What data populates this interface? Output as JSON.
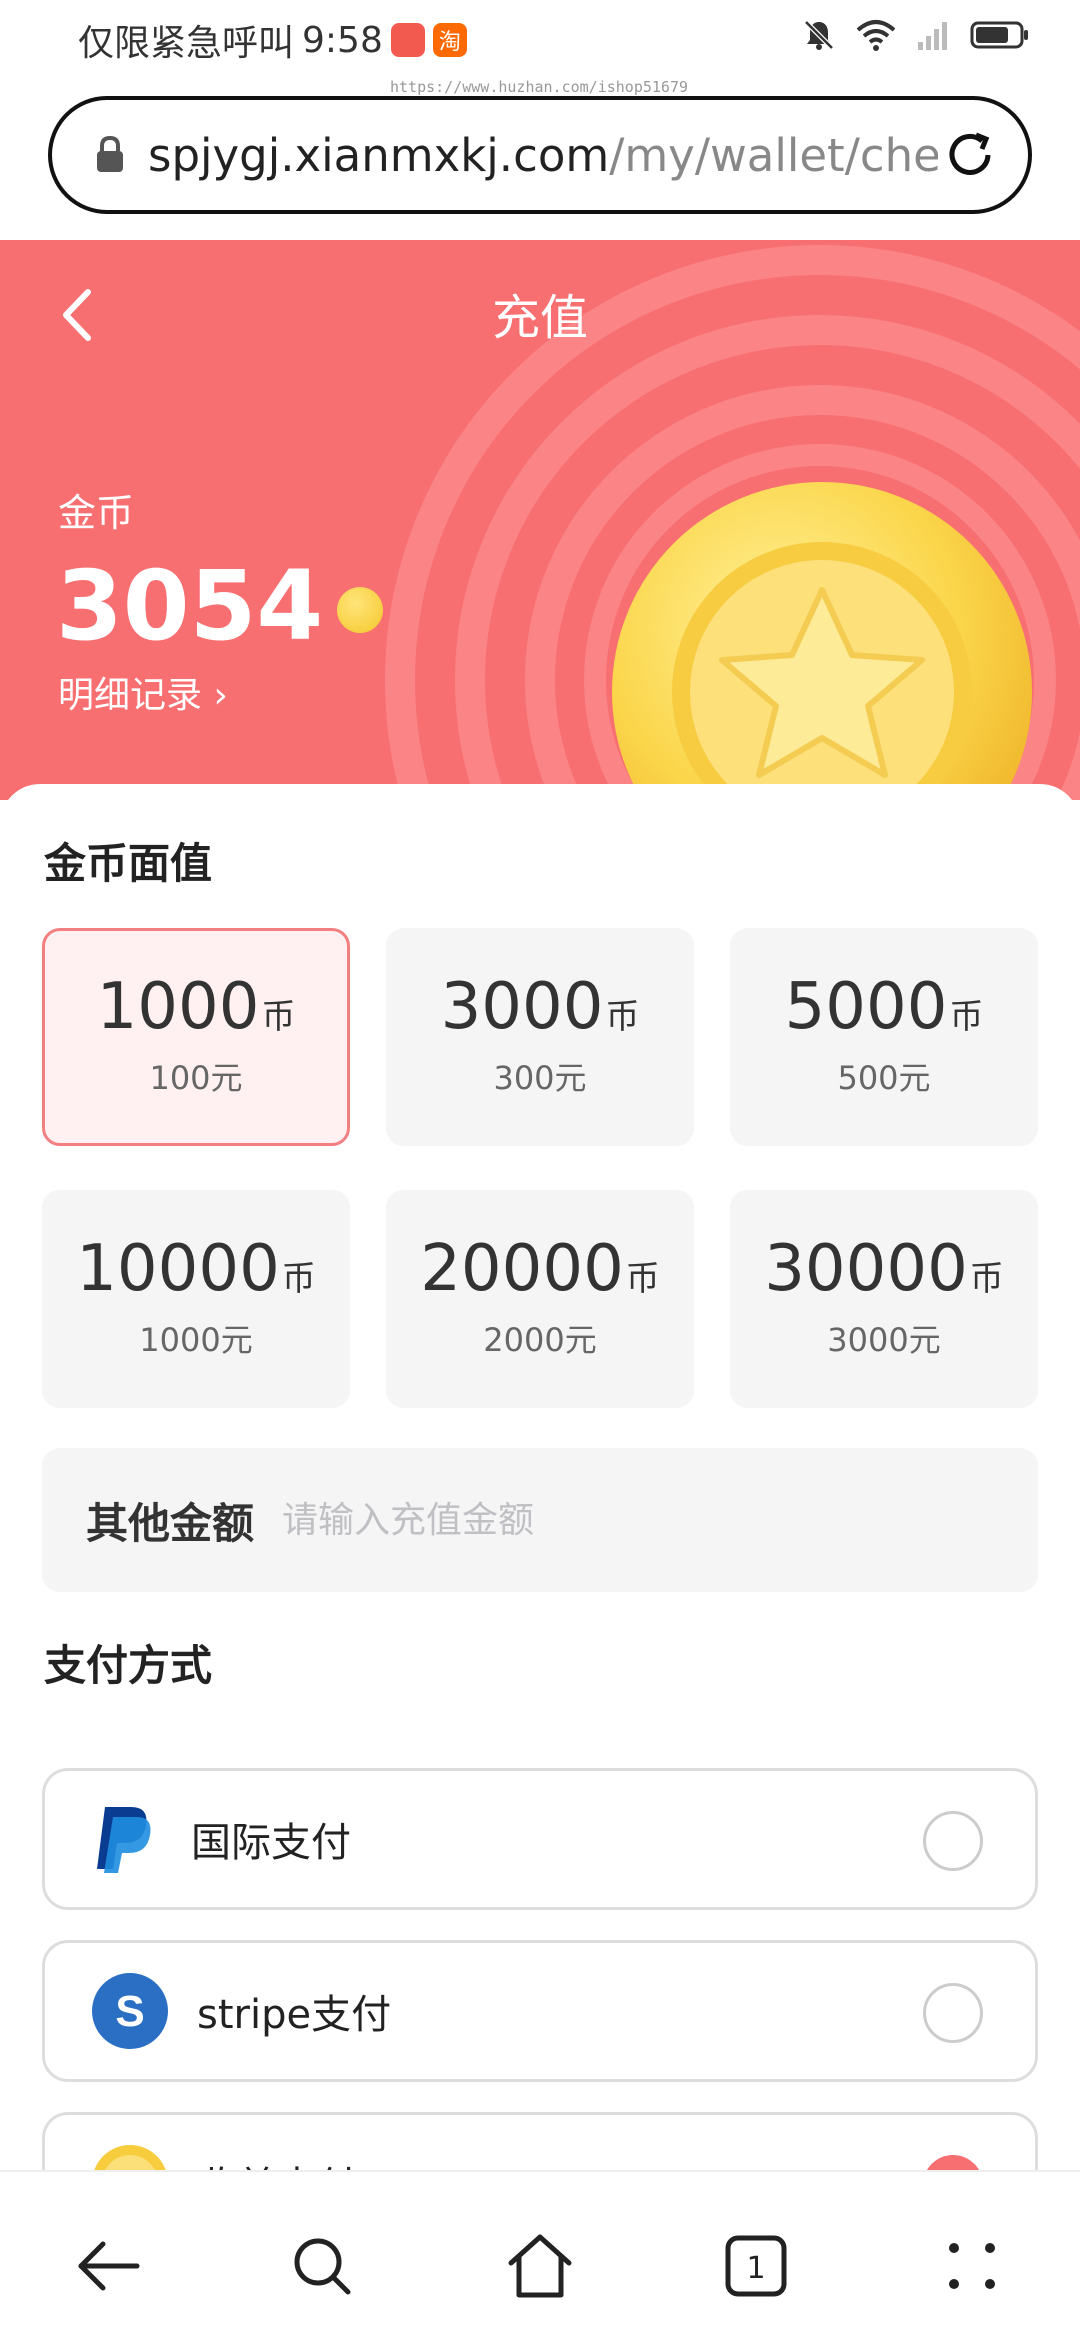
{
  "status_bar": {
    "carrier_text": "仅限紧急呼叫",
    "time": "9:58",
    "app_badge": "淘"
  },
  "browser": {
    "url_host": "spjygj.xianmxkj.com",
    "url_path": "/my/wallet/che",
    "watermark": "https://www.huzhan.com/ishop51679"
  },
  "header": {
    "title": "充值",
    "coin_label": "金币",
    "coin_balance": "3054",
    "detail_link": "明细记录 ›"
  },
  "denominations": {
    "title": "金币面值",
    "items": [
      {
        "coins": "1000",
        "unit": "币",
        "price": "100元",
        "selected": true
      },
      {
        "coins": "3000",
        "unit": "币",
        "price": "300元",
        "selected": false
      },
      {
        "coins": "5000",
        "unit": "币",
        "price": "500元",
        "selected": false
      },
      {
        "coins": "10000",
        "unit": "币",
        "price": "1000元",
        "selected": false
      },
      {
        "coins": "20000",
        "unit": "币",
        "price": "2000元",
        "selected": false
      },
      {
        "coins": "30000",
        "unit": "币",
        "price": "3000元",
        "selected": false
      }
    ],
    "other_label": "其他金额",
    "other_placeholder": "请输入充值金额"
  },
  "payment": {
    "title": "支付方式",
    "methods": [
      {
        "name": "国际支付",
        "icon": "paypal-icon",
        "selected": false
      },
      {
        "name": "stripe支付",
        "icon": "stripe-icon",
        "selected": false
      },
      {
        "name": "收益支付",
        "icon": "coin-icon",
        "selected": true
      }
    ]
  },
  "colors": {
    "accent": "#f86f71",
    "coin_gold": "#f4c62a"
  }
}
